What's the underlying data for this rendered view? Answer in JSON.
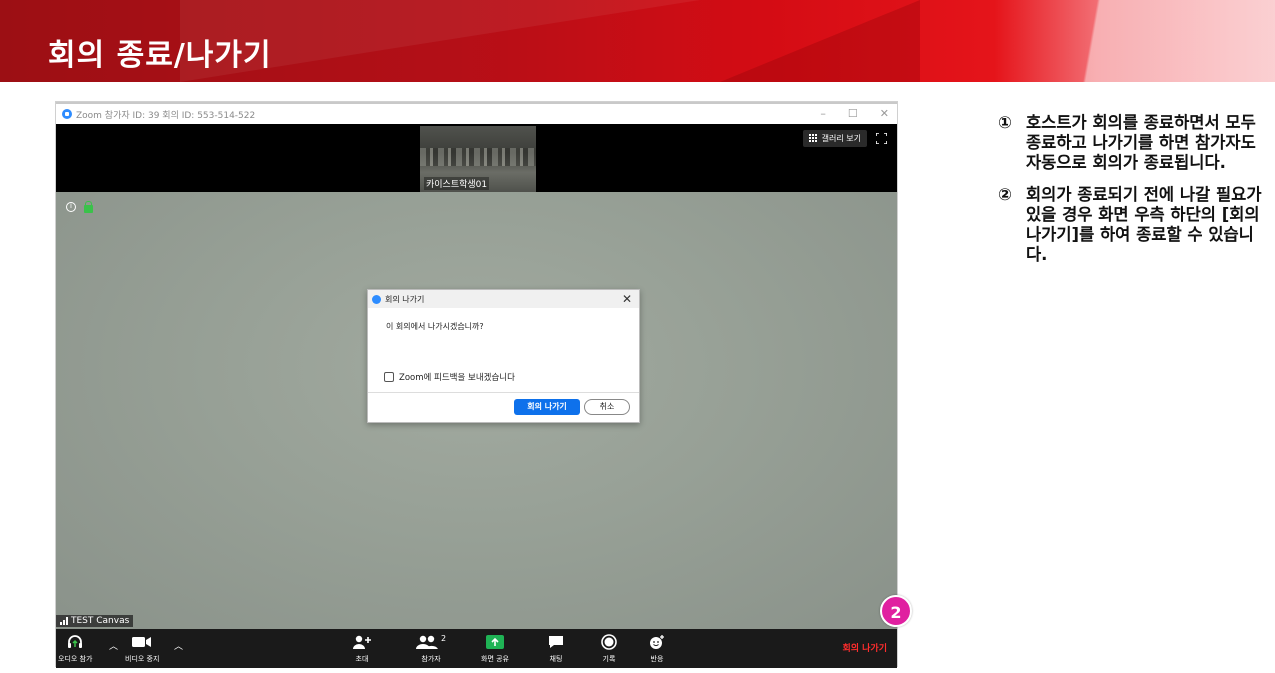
{
  "slide": {
    "title": "회의 종료/나가기",
    "notes": [
      {
        "num": "①",
        "text": "호스트가 회의를 종료하면서 모두 종료하고 나가기를 하면 참가자도 자동으로 회의가 종료됩니다."
      },
      {
        "num": "②",
        "text": "회의가 종료되기 전에 나갈 필요가 있을 경우 화면 우측 하단의 [회의 나가기]를 하여 종료할 수 있습니다."
      }
    ],
    "badge": "2"
  },
  "zoom": {
    "window_title": "Zoom 참가자 ID: 39   회의 ID: 553-514-522",
    "window_controls": [
      "–",
      "☐",
      "✕"
    ],
    "thumbnail_name": "카이스트학생01",
    "gallery_label": "갤러리 보기",
    "canvas_label": "TEST Canvas",
    "dialog": {
      "title": "회의 나가기",
      "message": "이 회의에서 나가시겠습니까?",
      "checkbox_label": "Zoom에 피드백을 보내겠습니다",
      "leave_button": "회의 나가기",
      "cancel_button": "취소"
    },
    "toolbar": {
      "audio": "오디오 참가",
      "video": "비디오 중지",
      "invite": "초대",
      "participants": "참가자",
      "participants_count": "2",
      "share": "화면 공유",
      "chat": "채팅",
      "record": "기록",
      "reactions": "반응",
      "leave": "회의 나가기"
    },
    "colors": {
      "accent": "#0e71eb",
      "leave_red": "#ff2d2d",
      "share_green": "#1fb355",
      "banner_red": "#c4101a"
    }
  }
}
